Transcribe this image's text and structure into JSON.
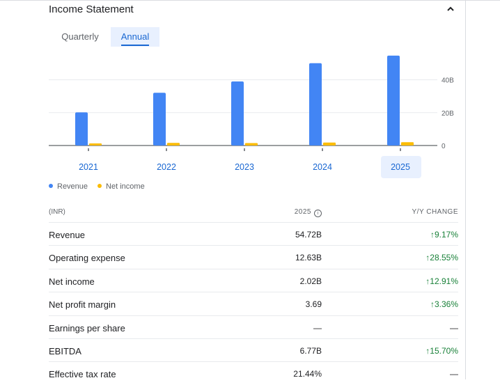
{
  "header": {
    "title": "Income Statement"
  },
  "tabs": [
    {
      "label": "Quarterly"
    },
    {
      "label": "Annual"
    }
  ],
  "legend": [
    {
      "label": "Revenue",
      "color": "#4285f4"
    },
    {
      "label": "Net income",
      "color": "#fbbc04"
    }
  ],
  "chart_data": {
    "type": "bar",
    "categories": [
      "2021",
      "2022",
      "2023",
      "2024",
      "2025"
    ],
    "series": [
      {
        "name": "Revenue",
        "color": "#4285f4",
        "values": [
          20.2,
          32.1,
          39.0,
          50.1,
          54.72
        ]
      },
      {
        "name": "Net income",
        "color": "#fbbc04",
        "values": [
          0.9,
          1.6,
          1.5,
          1.8,
          2.02
        ]
      }
    ],
    "y_ticks": [
      {
        "value": 0,
        "label": "0"
      },
      {
        "value": 20,
        "label": "20B"
      },
      {
        "value": 40,
        "label": "40B"
      }
    ],
    "ylim": [
      0,
      60
    ],
    "highlighted_category": "2025"
  },
  "table": {
    "header": {
      "unit": "(INR)",
      "year": "2025",
      "change": "Y/Y CHANGE"
    },
    "rows": [
      {
        "label": "Revenue",
        "value": "54.72B",
        "change": "↑9.17%"
      },
      {
        "label": "Operating expense",
        "value": "12.63B",
        "change": "↑28.55%"
      },
      {
        "label": "Net income",
        "value": "2.02B",
        "change": "↑12.91%"
      },
      {
        "label": "Net profit margin",
        "value": "3.69",
        "change": "↑3.36%"
      },
      {
        "label": "Earnings per share",
        "value": "—",
        "change": "—"
      },
      {
        "label": "EBITDA",
        "value": "6.77B",
        "change": "↑15.70%"
      },
      {
        "label": "Effective tax rate",
        "value": "21.44%",
        "change": "—"
      }
    ]
  }
}
